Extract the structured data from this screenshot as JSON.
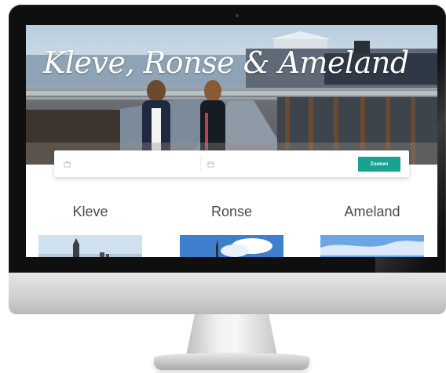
{
  "hero": {
    "title": "Kleve, Ronse & Ameland"
  },
  "search": {
    "location_placeholder": "",
    "date_placeholder": "",
    "location_icon": "suitcase-icon",
    "date_icon": "calendar-icon",
    "button_label": "Zoeken",
    "button_color": "#17a392"
  },
  "destinations": [
    {
      "name": "Kleve"
    },
    {
      "name": "Ronse"
    },
    {
      "name": "Ameland"
    }
  ]
}
